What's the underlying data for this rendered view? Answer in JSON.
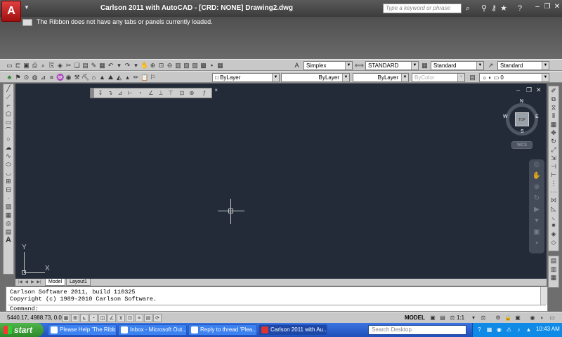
{
  "window": {
    "title": "Carlson 2011 with AutoCAD - [CRD: NONE]   Drawing2.dwg",
    "app_button": "A",
    "search_placeholder": "Type a keyword or phrase"
  },
  "ribbon": {
    "message": "The Ribbon does not have any tabs or panels currently loaded."
  },
  "toolbar": {
    "text_style": "Simplex",
    "dim_style": "STANDARD",
    "table_style": "Standard",
    "multileader_style": "Standard",
    "color": "ByLayer",
    "linetype": "ByLayer",
    "lineweight": "ByLayer",
    "plot_style": "ByColor",
    "layer": "0"
  },
  "viewcube": {
    "north": "N",
    "south": "S",
    "east": "E",
    "west": "W",
    "top": "TOP",
    "wcs": "WCS"
  },
  "ucs": {
    "x": "X",
    "y": "Y"
  },
  "tabs": [
    "Model",
    "Layout1"
  ],
  "command": {
    "line1": "Carlson Software 2011, build 110325",
    "line2": "Copyright (c) 1989-2010 Carlson Software.",
    "prompt": "Command:"
  },
  "status": {
    "coords": "5440.17, 4988.73, 0.00",
    "model": "MODEL",
    "scale": "1:1"
  },
  "taskbar": {
    "start": "start",
    "tasks": [
      "Please Help 'The Ribb...",
      "Inbox - Microsoft Out...",
      "Reply to thread 'Plea...",
      "Carlson 2011 with Au..."
    ],
    "search_placeholder": "Search Desktop",
    "clock": "10:43 AM"
  },
  "colors": {
    "canvas": "#232b38",
    "titlebar": "#3c3c3c",
    "taskbar": "#1f4fb8",
    "start": "#2e8a2a"
  }
}
